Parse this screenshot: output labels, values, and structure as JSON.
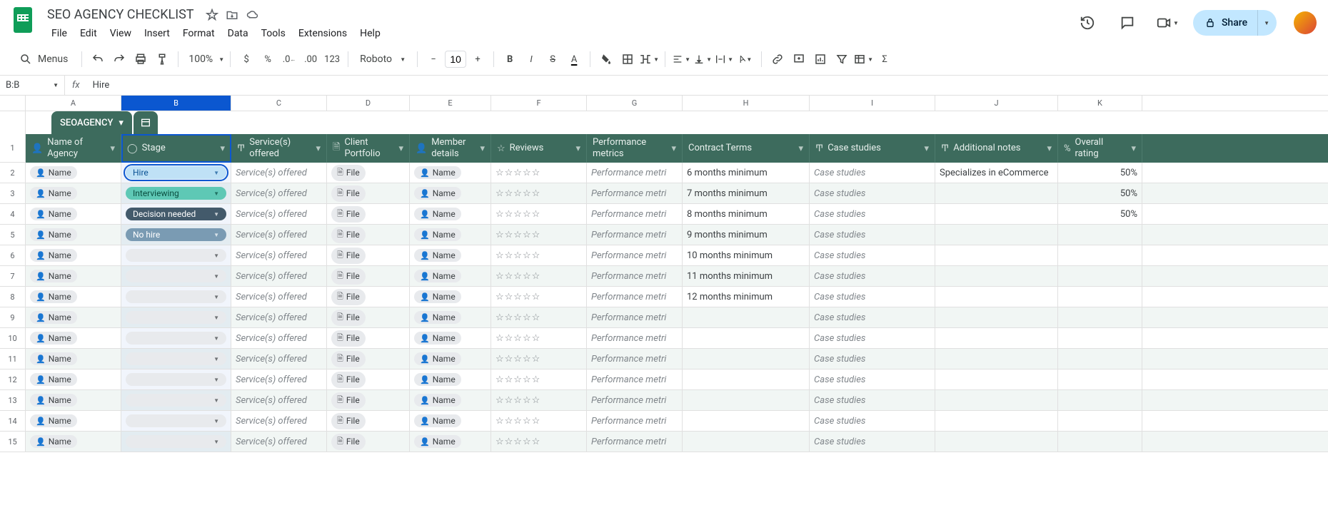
{
  "doc": {
    "title": "SEO AGENCY CHECKLIST"
  },
  "menus": [
    "File",
    "Edit",
    "View",
    "Insert",
    "Format",
    "Data",
    "Tools",
    "Extensions",
    "Help"
  ],
  "share": "Share",
  "toolbar": {
    "search": "Menus",
    "zoom": "100%",
    "font": "Roboto",
    "font_size": "10"
  },
  "namebox": "B:B",
  "formula": "Hire",
  "col_letters": [
    "A",
    "B",
    "C",
    "D",
    "E",
    "F",
    "G",
    "H",
    "I",
    "J",
    "K"
  ],
  "tab_name": "SEOAGENCY",
  "headers": {
    "name": "Name of Agency",
    "stage": "Stage",
    "services": "Service(s) offered",
    "portfolio": "Client Portfolio",
    "member": "Member details",
    "reviews": "Reviews",
    "perf": "Performance metrics",
    "contract": "Contract Terms",
    "cases": "Case studies",
    "notes": "Additional notes",
    "rating": "Overall rating"
  },
  "placeholders": {
    "name": "Name",
    "services": "Service(s) offered",
    "file": "File",
    "member": "Name",
    "perf": "Performance metri",
    "cases": "Case studies"
  },
  "stages": {
    "hire": "Hire",
    "interviewing": "Interviewing",
    "decision": "Decision needed",
    "nohire": "No hire"
  },
  "rows": [
    {
      "stage": "hire",
      "contract": "6 months minimum",
      "notes": "Specializes in eCommerce",
      "rating": "50%"
    },
    {
      "stage": "interviewing",
      "contract": "7 months minimum",
      "notes": "",
      "rating": "50%"
    },
    {
      "stage": "decision",
      "contract": "8 months minimum",
      "notes": "",
      "rating": "50%"
    },
    {
      "stage": "nohire",
      "contract": "9 months minimum",
      "notes": "",
      "rating": ""
    },
    {
      "stage": "",
      "contract": "10 months minimum",
      "notes": "",
      "rating": ""
    },
    {
      "stage": "",
      "contract": "11 months minimum",
      "notes": "",
      "rating": ""
    },
    {
      "stage": "",
      "contract": "12 months minimum",
      "notes": "",
      "rating": ""
    },
    {
      "stage": "",
      "contract": "",
      "notes": "",
      "rating": ""
    },
    {
      "stage": "",
      "contract": "",
      "notes": "",
      "rating": ""
    },
    {
      "stage": "",
      "contract": "",
      "notes": "",
      "rating": ""
    },
    {
      "stage": "",
      "contract": "",
      "notes": "",
      "rating": ""
    },
    {
      "stage": "",
      "contract": "",
      "notes": "",
      "rating": ""
    },
    {
      "stage": "",
      "contract": "",
      "notes": "",
      "rating": ""
    },
    {
      "stage": "",
      "contract": "",
      "notes": "",
      "rating": ""
    }
  ],
  "stars": "☆☆☆☆☆"
}
